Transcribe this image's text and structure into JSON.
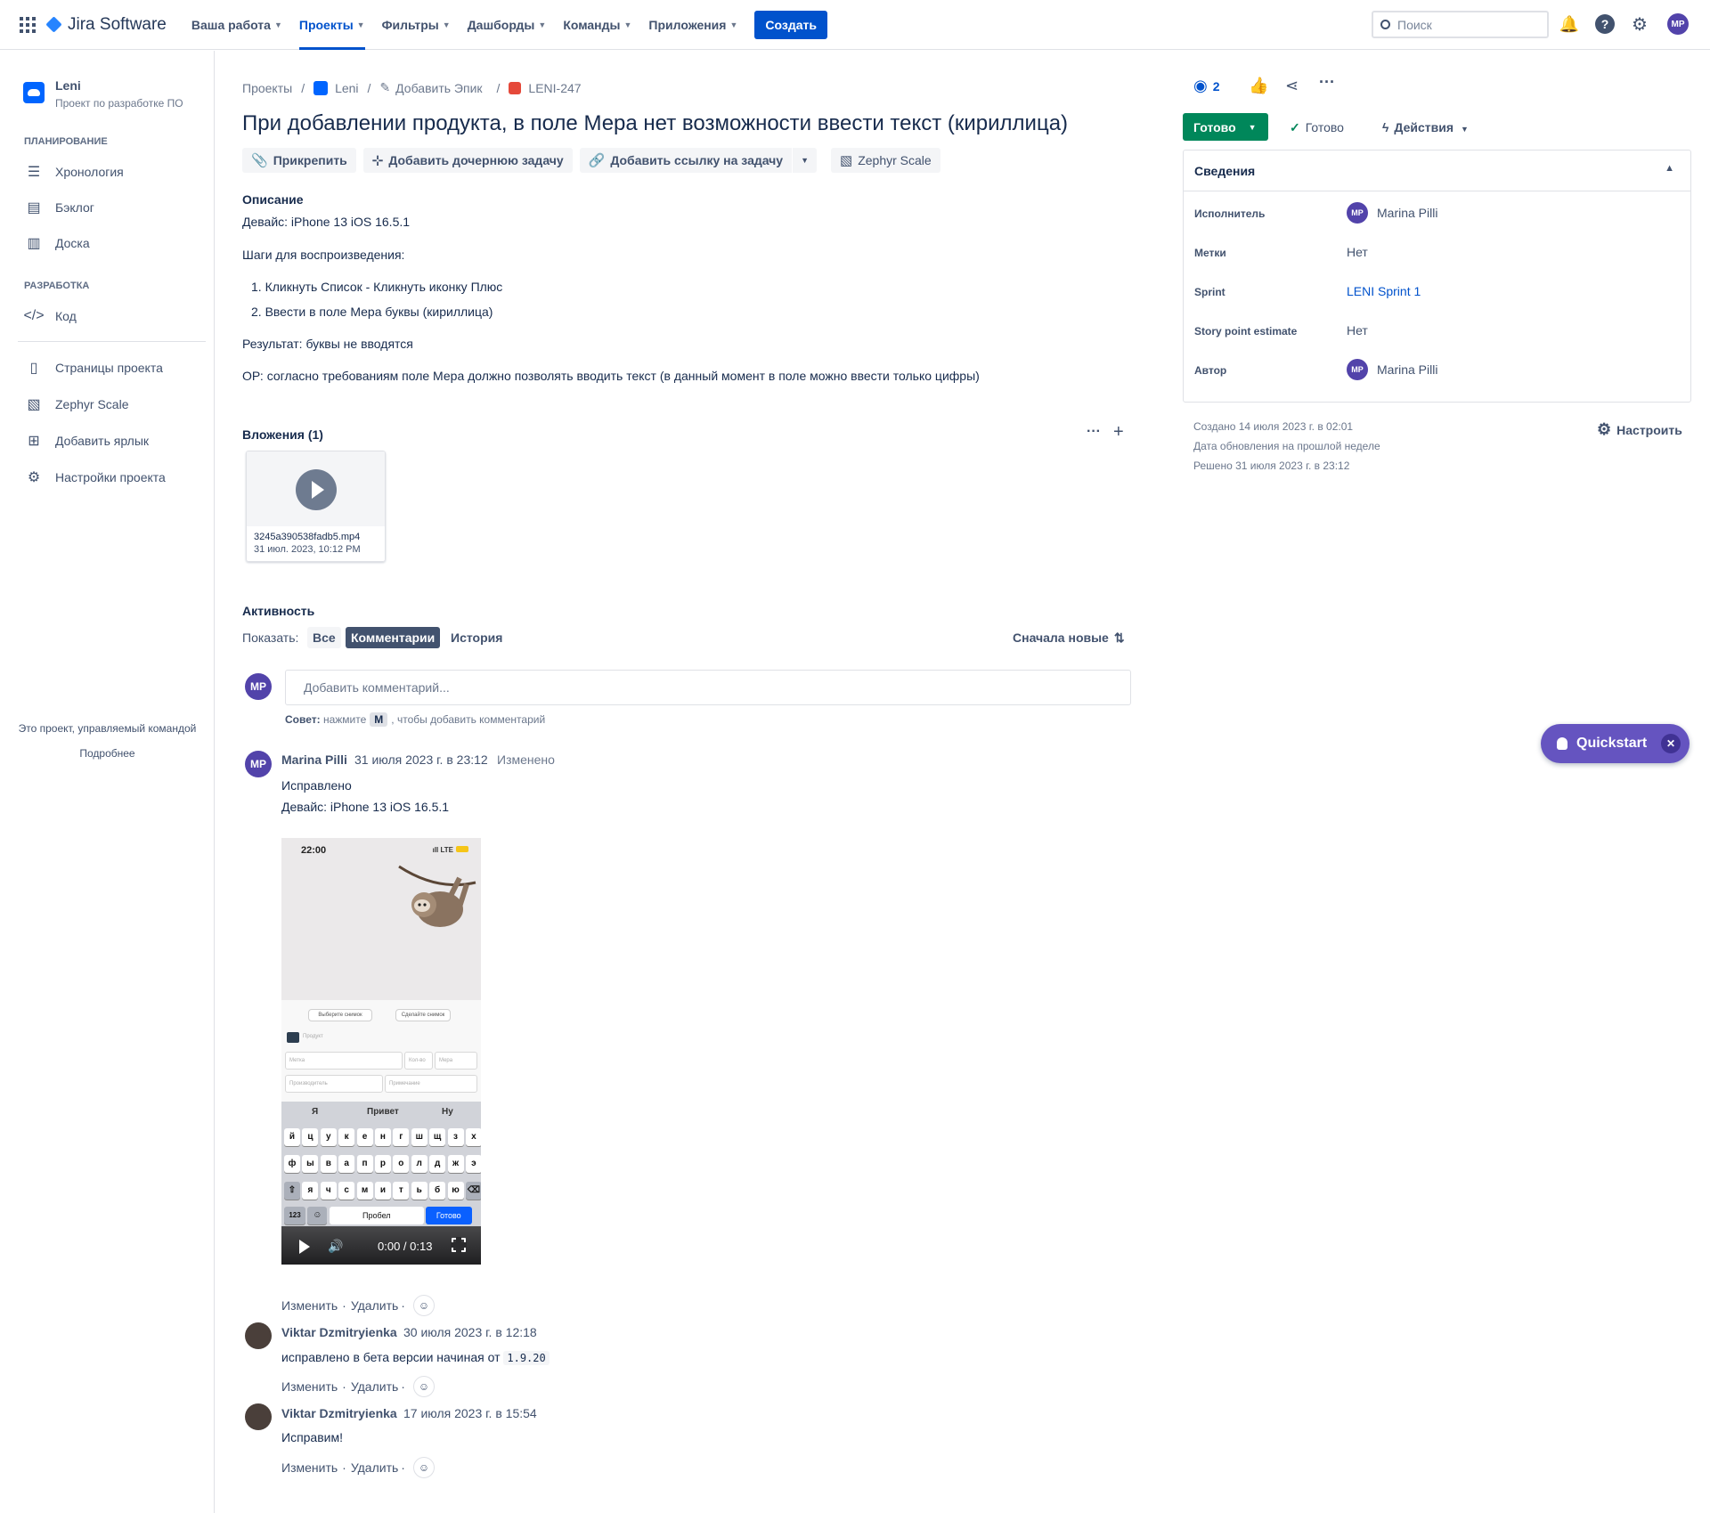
{
  "nav": {
    "brand": "Jira Software",
    "items": [
      "Ваша работа",
      "Проекты",
      "Фильтры",
      "Дашборды",
      "Команды",
      "Приложения"
    ],
    "create_label": "Создать",
    "search_placeholder": "Поиск",
    "user_initials": "MP"
  },
  "sidebar": {
    "project_name": "Leni",
    "project_type": "Проект по разработке ПО",
    "section_planning": "ПЛАНИРОВАНИЕ",
    "planning_items": [
      "Хронология",
      "Бэклог",
      "Доска"
    ],
    "section_dev": "РАЗРАБОТКА",
    "dev_items": [
      "Код"
    ],
    "other_items": [
      "Страницы проекта",
      "Zephyr Scale",
      "Добавить ярлык",
      "Настройки проекта"
    ],
    "footer_text": "Это проект, управляемый командой",
    "footer_link": "Подробнее"
  },
  "breadcrumb": {
    "projects": "Проекты",
    "project": "Leni",
    "epic": "Добавить Эпик",
    "issue_key": "LENI-247"
  },
  "issue": {
    "title": "При добавлении продукта, в поле Мера нет возможности ввести текст (кириллица)",
    "actions": [
      "Прикрепить",
      "Добавить дочернюю задачу",
      "Добавить ссылку на задачу",
      "Zephyr Scale"
    ],
    "description_heading": "Описание",
    "device": "Девайс: iPhone 13 iOS 16.5.1",
    "steps_heading": "Шаги для воспроизведения:",
    "steps": [
      "1. Кликнуть Список - Кликнуть иконку Плюс",
      "2. Ввести в поле Мера буквы (кириллица)"
    ],
    "result": "Результат: буквы не вводятся",
    "expected": "ОР: согласно требованиям поле Мера должно позволять вводить текст (в данный момент в поле можно ввести только цифры)"
  },
  "attachments": {
    "heading": "Вложения (1)",
    "file_name": "3245a390538fadb5.mp4",
    "file_date": "31 июл. 2023, 10:12 PM"
  },
  "activity": {
    "heading": "Активность",
    "show_label": "Показать:",
    "tabs": [
      "Все",
      "Комментарии",
      "История"
    ],
    "sort_label": "Сначала новые",
    "comment_placeholder": "Добавить комментарий...",
    "tip_label": "Совет:",
    "tip_press": "нажмите",
    "tip_key": "M",
    "tip_rest": ", чтобы добавить комментарий",
    "edit_label": "Изменить",
    "delete_label": "Удалить",
    "dot": "·"
  },
  "comments": [
    {
      "author": "Marina Pilli",
      "initials": "MP",
      "date": "31 июля 2023 г. в 23:12",
      "edited": "Изменено",
      "lines": [
        "Исправлено",
        "Девайс: iPhone 13 iOS 16.5.1"
      ]
    },
    {
      "author": "Viktar Dzmitryienka",
      "date": "30 июля 2023 г. в 12:18",
      "text": "исправлено в бета версии начиная от",
      "code": "1.9.20"
    },
    {
      "author": "Viktar Dzmitryienka",
      "date": "17 июля 2023 г. в 15:54",
      "text": "Исправим!"
    }
  ],
  "video": {
    "status_time": "22:00",
    "status_net": "LTE",
    "buttons": [
      "Выберите снимок",
      "Сделайте снимок"
    ],
    "fields": [
      "Продукт",
      "Метка",
      "Кол-во",
      "Мера",
      "Производитель",
      "Примечание"
    ],
    "suggestions": [
      "Я",
      "Привет",
      "Ну"
    ],
    "row1": [
      "й",
      "ц",
      "у",
      "к",
      "е",
      "н",
      "г",
      "ш",
      "щ",
      "з",
      "х"
    ],
    "row2": [
      "ф",
      "ы",
      "в",
      "а",
      "п",
      "р",
      "о",
      "л",
      "д",
      "ж",
      "э"
    ],
    "row3": [
      "я",
      "ч",
      "с",
      "м",
      "и",
      "т",
      "ь",
      "б",
      "ю"
    ],
    "key_123": "123",
    "space": "Пробел",
    "done": "Готово",
    "time": "0:00 / 0:13"
  },
  "right": {
    "watchers": "2",
    "status": "Готово",
    "resolution": "Готово",
    "actions": "Действия",
    "details_heading": "Сведения",
    "fields": [
      {
        "label": "Исполнитель",
        "value": "Marina Pilli"
      },
      {
        "label": "Метки",
        "value": "Нет"
      },
      {
        "label": "Sprint",
        "value": "LENI Sprint 1"
      },
      {
        "label": "Story point estimate",
        "value": "Нет"
      },
      {
        "label": "Автор",
        "value": "Marina Pilli"
      }
    ],
    "created": "Создано 14 июля 2023 г. в 02:01",
    "updated": "Дата обновления на прошлой неделе",
    "resolved": "Решено 31 июля 2023 г. в 23:12",
    "configure": "Настроить"
  },
  "quickstart": {
    "label": "Quickstart"
  },
  "colors": {
    "primary": "#0052cc",
    "success": "#00875a",
    "accent": "#6554c0",
    "text": "#172b4d"
  }
}
